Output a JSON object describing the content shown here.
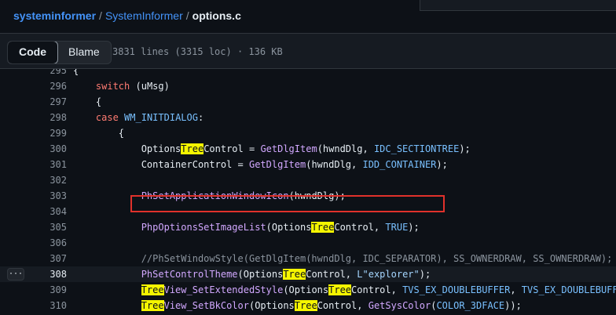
{
  "breadcrumb": {
    "owner": "systeminformer",
    "repo": "SystemInformer",
    "file": "options.c",
    "separator": "/"
  },
  "toolbar": {
    "code_label": "Code",
    "blame_label": "Blame",
    "file_info": "3831 lines (3315 loc) · 136 KB"
  },
  "line_menu": {
    "icon": "kebab-horizontal-icon",
    "glyph": "···"
  },
  "colors": {
    "background": "#0d1117",
    "link": "#4493f8",
    "function": "#d2a8ff",
    "keyword": "#ff7b72",
    "constant": "#79c0ff",
    "search_highlight": "#f5f500",
    "annotation_box": "#e0312b"
  },
  "search_term": "Tree",
  "code": {
    "highlighted_line": "308",
    "lines": [
      {
        "num": "295",
        "text": "{"
      },
      {
        "num": "296",
        "text": "    switch (uMsg)"
      },
      {
        "num": "297",
        "text": "    {"
      },
      {
        "num": "298",
        "text": "    case WM_INITDIALOG:"
      },
      {
        "num": "299",
        "text": "        {"
      },
      {
        "num": "300",
        "text": "            OptionsTreeControl = GetDlgItem(hwndDlg, IDC_SECTIONTREE);"
      },
      {
        "num": "301",
        "text": "            ContainerControl = GetDlgItem(hwndDlg, IDD_CONTAINER);"
      },
      {
        "num": "302",
        "text": ""
      },
      {
        "num": "303",
        "text": "            PhSetApplicationWindowIcon(hwndDlg);"
      },
      {
        "num": "304",
        "text": ""
      },
      {
        "num": "305",
        "text": "            PhpOptionsSetImageList(OptionsTreeControl, TRUE);"
      },
      {
        "num": "306",
        "text": ""
      },
      {
        "num": "307",
        "text": "            //PhSetWindowStyle(GetDlgItem(hwndDlg, IDC_SEPARATOR), SS_OWNERDRAW, SS_OWNERDRAW);"
      },
      {
        "num": "308",
        "text": "            PhSetControlTheme(OptionsTreeControl, L\"explorer\");"
      },
      {
        "num": "309",
        "text": "            TreeView_SetExtendedStyle(OptionsTreeControl, TVS_EX_DOUBLEBUFFER, TVS_EX_DOUBLEBUFFER);"
      },
      {
        "num": "310",
        "text": "            TreeView_SetBkColor(OptionsTreeControl, GetSysColor(COLOR_3DFACE));"
      }
    ]
  }
}
